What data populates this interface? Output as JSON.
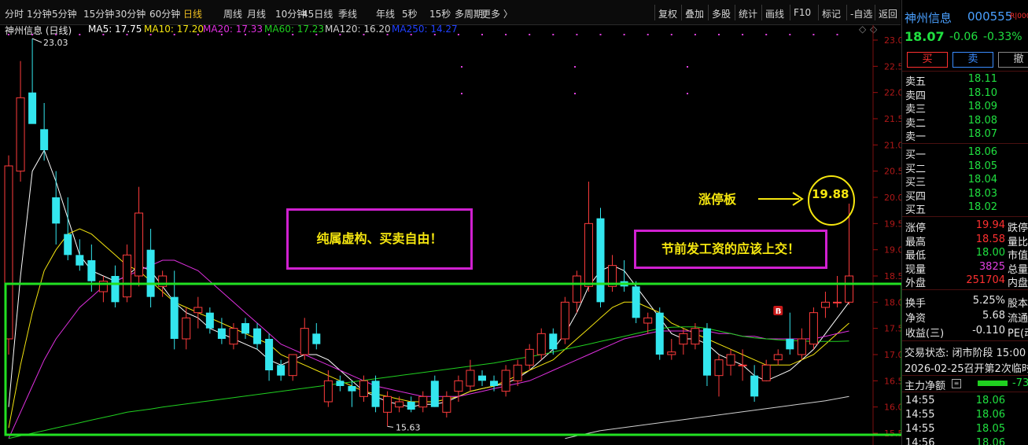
{
  "toolbar": {
    "periods": [
      "分时",
      "1分钟",
      "5分钟",
      "15分钟",
      "30分钟",
      "60分钟",
      "日线",
      "周线",
      "月线",
      "10分钟",
      "45日线",
      "季线",
      "年线",
      "5秒",
      "15秒",
      "多周期",
      "更多 〉"
    ],
    "active_period": "日线",
    "right_buttons": [
      "复权",
      "叠加",
      "多股",
      "统计",
      "画线",
      "F10",
      "标记",
      "-自选",
      "返回"
    ]
  },
  "legend": {
    "title": "神州信息 (日线)",
    "items": [
      {
        "label": "MA5: 17.75",
        "color": "#ffffff"
      },
      {
        "label": "MA10: 17.20",
        "color": "#f5e60f"
      },
      {
        "label": "MA20: 17.33",
        "color": "#e030e0"
      },
      {
        "label": "MA60: 17.23",
        "color": "#20d020"
      },
      {
        "label": "MA120: 16.20",
        "color": "#d0d0d0"
      },
      {
        "label": "MA250: 14.27",
        "color": "#2040ff"
      }
    ]
  },
  "annotations": {
    "left_box": "纯属虚构、买卖自由！",
    "right_box": "节前发工资的应该上交！",
    "limit_up_label": "涨停板",
    "circle_price": "19.88"
  },
  "chart_data": {
    "type": "candlestick",
    "y_axis_ticks": [
      "23.00",
      "22.50",
      "22.00",
      "21.50",
      "21.00",
      "20.50",
      "20.00",
      "19.50",
      "19.00",
      "18.50",
      "18.00",
      "17.50",
      "17.00",
      "16.50",
      "16.00",
      "15.50"
    ],
    "ylim": [
      15.45,
      23.15
    ],
    "high_label": "23.03",
    "low_label": "15.63",
    "signal_marker": "B",
    "candles": [
      {
        "o": 17.3,
        "h": 20.8,
        "l": 17.0,
        "c": 20.6
      },
      {
        "o": 20.5,
        "h": 22.6,
        "l": 20.3,
        "c": 21.9
      },
      {
        "o": 22.0,
        "h": 23.03,
        "l": 21.5,
        "c": 21.4
      },
      {
        "o": 21.3,
        "h": 21.8,
        "l": 20.7,
        "c": 20.9
      },
      {
        "o": 20.0,
        "h": 20.5,
        "l": 19.1,
        "c": 19.5
      },
      {
        "o": 19.3,
        "h": 20.0,
        "l": 18.8,
        "c": 18.9
      },
      {
        "o": 18.9,
        "h": 19.2,
        "l": 18.6,
        "c": 18.7
      },
      {
        "o": 18.8,
        "h": 19.1,
        "l": 18.2,
        "c": 18.4
      },
      {
        "o": 18.2,
        "h": 18.5,
        "l": 18.0,
        "c": 18.4
      },
      {
        "o": 18.5,
        "h": 18.7,
        "l": 17.9,
        "c": 18.0
      },
      {
        "o": 18.1,
        "h": 19.1,
        "l": 18.0,
        "c": 18.9
      },
      {
        "o": 18.5,
        "h": 20.2,
        "l": 18.3,
        "c": 19.7
      },
      {
        "o": 19.0,
        "h": 19.4,
        "l": 17.9,
        "c": 18.1
      },
      {
        "o": 18.3,
        "h": 18.6,
        "l": 18.1,
        "c": 18.5
      },
      {
        "o": 18.1,
        "h": 18.6,
        "l": 17.1,
        "c": 17.3
      },
      {
        "o": 17.3,
        "h": 17.9,
        "l": 17.1,
        "c": 17.7
      },
      {
        "o": 17.8,
        "h": 18.1,
        "l": 17.5,
        "c": 17.9
      },
      {
        "o": 17.8,
        "h": 17.9,
        "l": 17.4,
        "c": 17.5
      },
      {
        "o": 17.5,
        "h": 17.7,
        "l": 17.2,
        "c": 17.3
      },
      {
        "o": 17.2,
        "h": 17.6,
        "l": 17.1,
        "c": 17.5
      },
      {
        "o": 17.6,
        "h": 17.7,
        "l": 17.3,
        "c": 17.4
      },
      {
        "o": 17.5,
        "h": 17.6,
        "l": 17.1,
        "c": 17.2
      },
      {
        "o": 17.3,
        "h": 17.4,
        "l": 16.5,
        "c": 16.7
      },
      {
        "o": 16.8,
        "h": 16.9,
        "l": 16.5,
        "c": 16.6
      },
      {
        "o": 16.6,
        "h": 17.0,
        "l": 16.5,
        "c": 17.0
      },
      {
        "o": 17.0,
        "h": 17.7,
        "l": 16.9,
        "c": 17.5
      },
      {
        "o": 17.4,
        "h": 17.6,
        "l": 17.1,
        "c": 17.2
      },
      {
        "o": 16.1,
        "h": 16.7,
        "l": 16.0,
        "c": 16.5
      },
      {
        "o": 16.5,
        "h": 16.6,
        "l": 16.3,
        "c": 16.4
      },
      {
        "o": 16.4,
        "h": 16.5,
        "l": 16.0,
        "c": 16.3
      },
      {
        "o": 16.2,
        "h": 16.6,
        "l": 16.1,
        "c": 16.5
      },
      {
        "o": 16.5,
        "h": 16.6,
        "l": 15.9,
        "c": 16.0
      },
      {
        "o": 15.9,
        "h": 16.3,
        "l": 15.63,
        "c": 16.2
      },
      {
        "o": 16.0,
        "h": 16.2,
        "l": 15.9,
        "c": 16.1
      },
      {
        "o": 16.1,
        "h": 16.2,
        "l": 15.9,
        "c": 15.95
      },
      {
        "o": 16.0,
        "h": 16.3,
        "l": 15.9,
        "c": 16.2
      },
      {
        "o": 16.5,
        "h": 16.6,
        "l": 16.0,
        "c": 16.0
      },
      {
        "o": 15.9,
        "h": 16.3,
        "l": 15.8,
        "c": 16.2
      },
      {
        "o": 16.3,
        "h": 16.6,
        "l": 16.1,
        "c": 16.5
      },
      {
        "o": 16.4,
        "h": 16.9,
        "l": 16.3,
        "c": 16.7
      },
      {
        "o": 16.6,
        "h": 16.7,
        "l": 16.4,
        "c": 16.5
      },
      {
        "o": 16.5,
        "h": 16.6,
        "l": 16.3,
        "c": 16.4
      },
      {
        "o": 16.3,
        "h": 16.8,
        "l": 16.2,
        "c": 16.7
      },
      {
        "o": 16.5,
        "h": 16.9,
        "l": 16.4,
        "c": 16.8
      },
      {
        "o": 16.8,
        "h": 17.2,
        "l": 16.7,
        "c": 17.1
      },
      {
        "o": 17.0,
        "h": 17.5,
        "l": 16.9,
        "c": 17.4
      },
      {
        "o": 17.4,
        "h": 17.5,
        "l": 17.0,
        "c": 17.1
      },
      {
        "o": 17.3,
        "h": 18.1,
        "l": 17.2,
        "c": 18.0
      },
      {
        "o": 18.0,
        "h": 18.6,
        "l": 17.8,
        "c": 18.5
      },
      {
        "o": 18.3,
        "h": 20.3,
        "l": 18.2,
        "c": 19.5
      },
      {
        "o": 19.6,
        "h": 19.8,
        "l": 17.9,
        "c": 18.0
      },
      {
        "o": 18.3,
        "h": 18.9,
        "l": 18.2,
        "c": 18.7
      },
      {
        "o": 18.4,
        "h": 18.8,
        "l": 18.2,
        "c": 18.3
      },
      {
        "o": 18.3,
        "h": 18.4,
        "l": 17.6,
        "c": 17.7
      },
      {
        "o": 17.6,
        "h": 17.8,
        "l": 17.4,
        "c": 17.7
      },
      {
        "o": 17.8,
        "h": 17.9,
        "l": 16.9,
        "c": 17.0
      },
      {
        "o": 17.0,
        "h": 17.3,
        "l": 16.9,
        "c": 17.05
      },
      {
        "o": 17.2,
        "h": 17.5,
        "l": 17.0,
        "c": 17.4
      },
      {
        "o": 17.2,
        "h": 17.6,
        "l": 17.1,
        "c": 17.5
      },
      {
        "o": 17.5,
        "h": 17.6,
        "l": 16.4,
        "c": 16.6
      },
      {
        "o": 16.6,
        "h": 17.0,
        "l": 16.2,
        "c": 16.9
      },
      {
        "o": 16.8,
        "h": 17.1,
        "l": 16.6,
        "c": 17.0
      },
      {
        "o": 16.8,
        "h": 17.1,
        "l": 16.5,
        "c": 16.8
      },
      {
        "o": 16.6,
        "h": 16.8,
        "l": 16.1,
        "c": 16.2
      },
      {
        "o": 16.5,
        "h": 16.9,
        "l": 16.5,
        "c": 16.8
      },
      {
        "o": 16.9,
        "h": 17.1,
        "l": 16.8,
        "c": 17.0
      },
      {
        "o": 17.3,
        "h": 17.8,
        "l": 17.0,
        "c": 17.1
      },
      {
        "o": 17.0,
        "h": 17.5,
        "l": 16.9,
        "c": 17.3
      },
      {
        "o": 17.2,
        "h": 17.9,
        "l": 17.1,
        "c": 17.8
      },
      {
        "o": 17.9,
        "h": 18.2,
        "l": 17.7,
        "c": 18.0
      },
      {
        "o": 18.0,
        "h": 18.5,
        "l": 17.9,
        "c": 18.0
      },
      {
        "o": 18.0,
        "h": 19.88,
        "l": 17.95,
        "c": 18.5
      }
    ],
    "ma_series": [
      {
        "name": "MA5",
        "color": "#ffffff",
        "values": [
          16.0,
          18.5,
          20.5,
          20.9,
          20.3,
          19.6,
          18.9,
          18.6,
          18.5,
          18.4,
          18.5,
          18.7,
          18.6,
          18.3,
          18.0,
          17.8,
          17.7,
          17.5,
          17.4,
          17.3,
          17.2,
          17.1,
          16.9,
          16.8,
          16.9,
          17.0,
          17.0,
          16.9,
          16.7,
          16.5,
          16.3,
          16.2,
          16.1,
          16.05,
          16.0,
          16.05,
          16.05,
          16.1,
          16.2,
          16.3,
          16.35,
          16.4,
          16.45,
          16.55,
          16.7,
          16.9,
          17.1,
          17.4,
          17.8,
          18.3,
          18.6,
          18.7,
          18.6,
          18.3,
          18.0,
          17.7,
          17.4,
          17.3,
          17.3,
          17.2,
          17.0,
          16.9,
          16.8,
          16.6,
          16.5,
          16.6,
          16.7,
          16.9,
          17.1,
          17.4,
          17.7,
          18.0
        ]
      },
      {
        "name": "MA10",
        "color": "#f5e60f",
        "values": [
          15.6,
          16.8,
          17.8,
          18.6,
          19.0,
          19.3,
          19.4,
          19.3,
          19.1,
          18.9,
          18.7,
          18.6,
          18.4,
          18.2,
          18.0,
          17.9,
          17.8,
          17.7,
          17.6,
          17.5,
          17.4,
          17.3,
          17.2,
          17.0,
          16.9,
          16.8,
          16.7,
          16.6,
          16.5,
          16.4,
          16.3,
          16.25,
          16.2,
          16.15,
          16.1,
          16.1,
          16.1,
          16.15,
          16.2,
          16.3,
          16.35,
          16.4,
          16.5,
          16.6,
          16.7,
          16.8,
          16.9,
          17.1,
          17.3,
          17.5,
          17.7,
          17.9,
          18.0,
          18.0,
          17.9,
          17.8,
          17.6,
          17.5,
          17.4,
          17.3,
          17.2,
          17.1,
          17.0,
          16.9,
          16.8,
          16.8,
          16.8,
          16.9,
          17.0,
          17.2,
          17.4,
          17.6
        ]
      },
      {
        "name": "MA20",
        "color": "#e030e0",
        "values": [
          15.4,
          15.9,
          16.4,
          16.9,
          17.3,
          17.6,
          17.9,
          18.1,
          18.3,
          18.4,
          18.5,
          18.6,
          18.7,
          18.8,
          18.8,
          18.7,
          18.6,
          18.4,
          18.2,
          18.0,
          17.8,
          17.6,
          17.4,
          17.2,
          17.1,
          17.0,
          16.9,
          16.8,
          16.7,
          16.6,
          16.5,
          16.4,
          16.35,
          16.3,
          16.25,
          16.2,
          16.2,
          16.2,
          16.2,
          16.25,
          16.3,
          16.35,
          16.4,
          16.45,
          16.5,
          16.6,
          16.7,
          16.8,
          16.9,
          17.0,
          17.1,
          17.2,
          17.3,
          17.35,
          17.4,
          17.45,
          17.45,
          17.45,
          17.45,
          17.45,
          17.4,
          17.4,
          17.35,
          17.35,
          17.3,
          17.3,
          17.3,
          17.3,
          17.3,
          17.35,
          17.4,
          17.45
        ]
      },
      {
        "name": "MA60",
        "color": "#20d020",
        "values": [
          15.4,
          15.45,
          15.5,
          15.55,
          15.6,
          15.65,
          15.7,
          15.75,
          15.8,
          15.85,
          15.9,
          15.93,
          15.96,
          16.0,
          16.03,
          16.06,
          16.09,
          16.12,
          16.15,
          16.18,
          16.21,
          16.24,
          16.27,
          16.3,
          16.33,
          16.36,
          16.39,
          16.42,
          16.45,
          16.48,
          16.51,
          16.54,
          16.57,
          16.6,
          16.63,
          16.66,
          16.69,
          16.72,
          16.75,
          16.78,
          16.81,
          16.84,
          16.88,
          16.92,
          16.96,
          17.0,
          17.05,
          17.1,
          17.15,
          17.2,
          17.25,
          17.3,
          17.35,
          17.4,
          17.45,
          17.5,
          17.52,
          17.53,
          17.53,
          17.5,
          17.45,
          17.4,
          17.35,
          17.32,
          17.3,
          17.28,
          17.27,
          17.26,
          17.25,
          17.25,
          17.25,
          17.26
        ]
      },
      {
        "name": "MA120",
        "color": "#d0d0d0",
        "values": [
          null,
          null,
          null,
          null,
          null,
          null,
          null,
          null,
          null,
          null,
          null,
          null,
          null,
          null,
          null,
          null,
          null,
          null,
          null,
          null,
          null,
          null,
          null,
          null,
          null,
          null,
          null,
          null,
          null,
          null,
          null,
          null,
          null,
          null,
          null,
          null,
          null,
          null,
          null,
          null,
          null,
          null,
          null,
          null,
          null,
          null,
          null,
          15.4,
          15.45,
          15.5,
          15.55,
          15.58,
          15.61,
          15.64,
          15.67,
          15.7,
          15.73,
          15.76,
          15.79,
          15.82,
          15.85,
          15.88,
          15.91,
          15.94,
          15.97,
          16.0,
          16.03,
          16.06,
          16.09,
          16.12,
          16.16,
          16.2
        ]
      }
    ]
  },
  "right_panel": {
    "stock_name": "神州信息",
    "stock_code": "000555",
    "badge": "R|000",
    "price": "18.07",
    "change": "-0.06",
    "change_pct": "-0.33%",
    "buttons": [
      "买",
      "卖",
      "撤"
    ],
    "asks": [
      {
        "label": "卖五",
        "price": "18.11"
      },
      {
        "label": "卖四",
        "price": "18.10"
      },
      {
        "label": "卖三",
        "price": "18.09"
      },
      {
        "label": "卖二",
        "price": "18.08"
      },
      {
        "label": "卖一",
        "price": "18.07"
      }
    ],
    "bids": [
      {
        "label": "买一",
        "price": "18.06"
      },
      {
        "label": "买二",
        "price": "18.05"
      },
      {
        "label": "买三",
        "price": "18.04"
      },
      {
        "label": "买四",
        "price": "18.03"
      },
      {
        "label": "买五",
        "price": "18.02"
      }
    ],
    "stats": [
      {
        "l1": "涨停",
        "v1": "19.94",
        "c1": "#ff3030",
        "l2": "跌停"
      },
      {
        "l1": "最高",
        "v1": "18.58",
        "c1": "#ff3030",
        "l2": "量比"
      },
      {
        "l1": "最低",
        "v1": "18.00",
        "c1": "#20e040",
        "l2": "市值"
      },
      {
        "l1": "现量",
        "v1": "3825",
        "c1": "#e040e0",
        "l2": "总量"
      },
      {
        "l1": "外盘",
        "v1": "251704",
        "c1": "#ff3030",
        "l2": "内盘"
      }
    ],
    "stats2": [
      {
        "l1": "换手",
        "v1": "5.25%",
        "c1": "#e6e6e6",
        "l2": "股本"
      },
      {
        "l1": "净资",
        "v1": "5.68",
        "c1": "#e6e6e6",
        "l2": "流通"
      },
      {
        "l1": "收益(三)",
        "v1": "-0.110",
        "c1": "#e6e6e6",
        "l2": "PE(动)"
      }
    ],
    "status_label": "交易状态: 闭市阶段 15:00",
    "notice": "2026-02-25召开第2次临时",
    "net_label": "主力净额",
    "net_value": "-73",
    "ticks": [
      {
        "time": "14:55",
        "price": "18.06"
      },
      {
        "time": "14:55",
        "price": "18.06"
      },
      {
        "time": "14:55",
        "price": "18.05"
      },
      {
        "time": "14:56",
        "price": "18.06"
      }
    ]
  }
}
